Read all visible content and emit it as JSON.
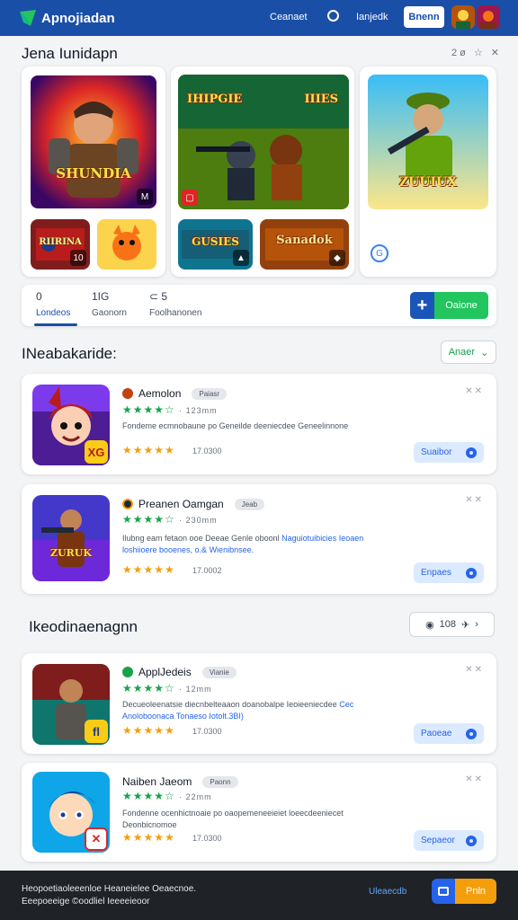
{
  "header": {
    "logo_text": "Apnojiadan",
    "link1": "Ceanaet",
    "link2": "Ianjedk",
    "button_label": "Bnenn",
    "brand_color": "#1a4fa8"
  },
  "featured": {
    "title": "Jena Iunidapn",
    "header_icons": "2ø ☆ ✕",
    "card1": {
      "main_caption": "SHUNDIA",
      "thumb1_caption": "RIIRINA",
      "thumb1_badge": "10",
      "main_badge": "M"
    },
    "card2": {
      "main_caption_left": "IHIPGIE",
      "main_caption_right": "IIIES",
      "thumb1_caption": "GUSIES",
      "thumb2_caption": "Sanadok"
    },
    "card3": {
      "main_caption": "ZUUIUX",
      "info_icon": "G"
    }
  },
  "tabs": {
    "items": [
      {
        "top": "0",
        "label": "Londeos"
      },
      {
        "top": "1IG",
        "label": "Gaonorn"
      },
      {
        "top": "⊂ 5",
        "label": "Foolhanonen"
      }
    ],
    "action_label": "Oaione"
  },
  "section2": {
    "title": "INeabakaride:",
    "dropdown_label": "Anaer"
  },
  "apps1": [
    {
      "name": "Aemolon",
      "tag": "Paiasr",
      "rating_line": "★★★★☆ ",
      "rating_meta": "· 123mm",
      "desc": "Fondeme ecmnobaune po Geneilde deeniecdee Geneelinnone",
      "desc_hl": "",
      "stars2": "★★★★★",
      "meta2": "17.0300",
      "action": "Suaibor",
      "dot_color": "#c2410c",
      "badge_text": "XG"
    },
    {
      "name": "Preanen Oamgan",
      "tag": "Jeab",
      "rating_line": "★★★★☆ ",
      "rating_meta": "· 230mm",
      "desc": "Ilubng eam fetaon ooe Deeae Genle oboonl",
      "desc_hl": "Naguiotuibicies Ieoaen loshiioere booenes, o.& Wienibnsee.",
      "stars2": "★★★★★",
      "meta2": "17.0002",
      "action": "Enpaes",
      "dot_color": "#1f2937",
      "badge_text": ""
    }
  ],
  "section3": {
    "title": "Ikeodinaenagnn",
    "pill_text": "108",
    "pill_icons": "◉ ✈ ›"
  },
  "apps2": [
    {
      "name": "ApplJedeis",
      "tag": "Vianie",
      "rating_line": "★★★★☆ ",
      "rating_meta": "· 12mm",
      "desc": "Decueoleenatsie diecnbelteaaon doanobalpe Ieoieeniecdee",
      "desc_hl": "Cec Anoloboonaca Tonaeso Iotolt.3BI)",
      "stars2": "★★★★★",
      "meta2": "17.0300",
      "action": "Paoeae",
      "dot_color": "#16a34a",
      "badge_text": "fl"
    },
    {
      "name": "Naiben Jaeom",
      "tag": "Paonn",
      "rating_line": "★★★★☆ ",
      "rating_meta": "· 22mm",
      "desc": "Fondenne ocenhictnoaie po oaopemeneeieiet loeecdeeniecet Deonbicnomoe",
      "desc_hl": "",
      "stars2": "★★★★★",
      "meta2": "17.0300",
      "action": "Sepaeor",
      "dot_color": "",
      "badge_text": "✕"
    }
  ],
  "footer": {
    "text_line1": "Heopoetiaoleeenloe Heaneielee Oeaecnoe.",
    "text_line2": "Eeepoeeige ©oodliel Ieeeeieoor",
    "link": "Uleaecdb",
    "button_label": "Pnln"
  }
}
